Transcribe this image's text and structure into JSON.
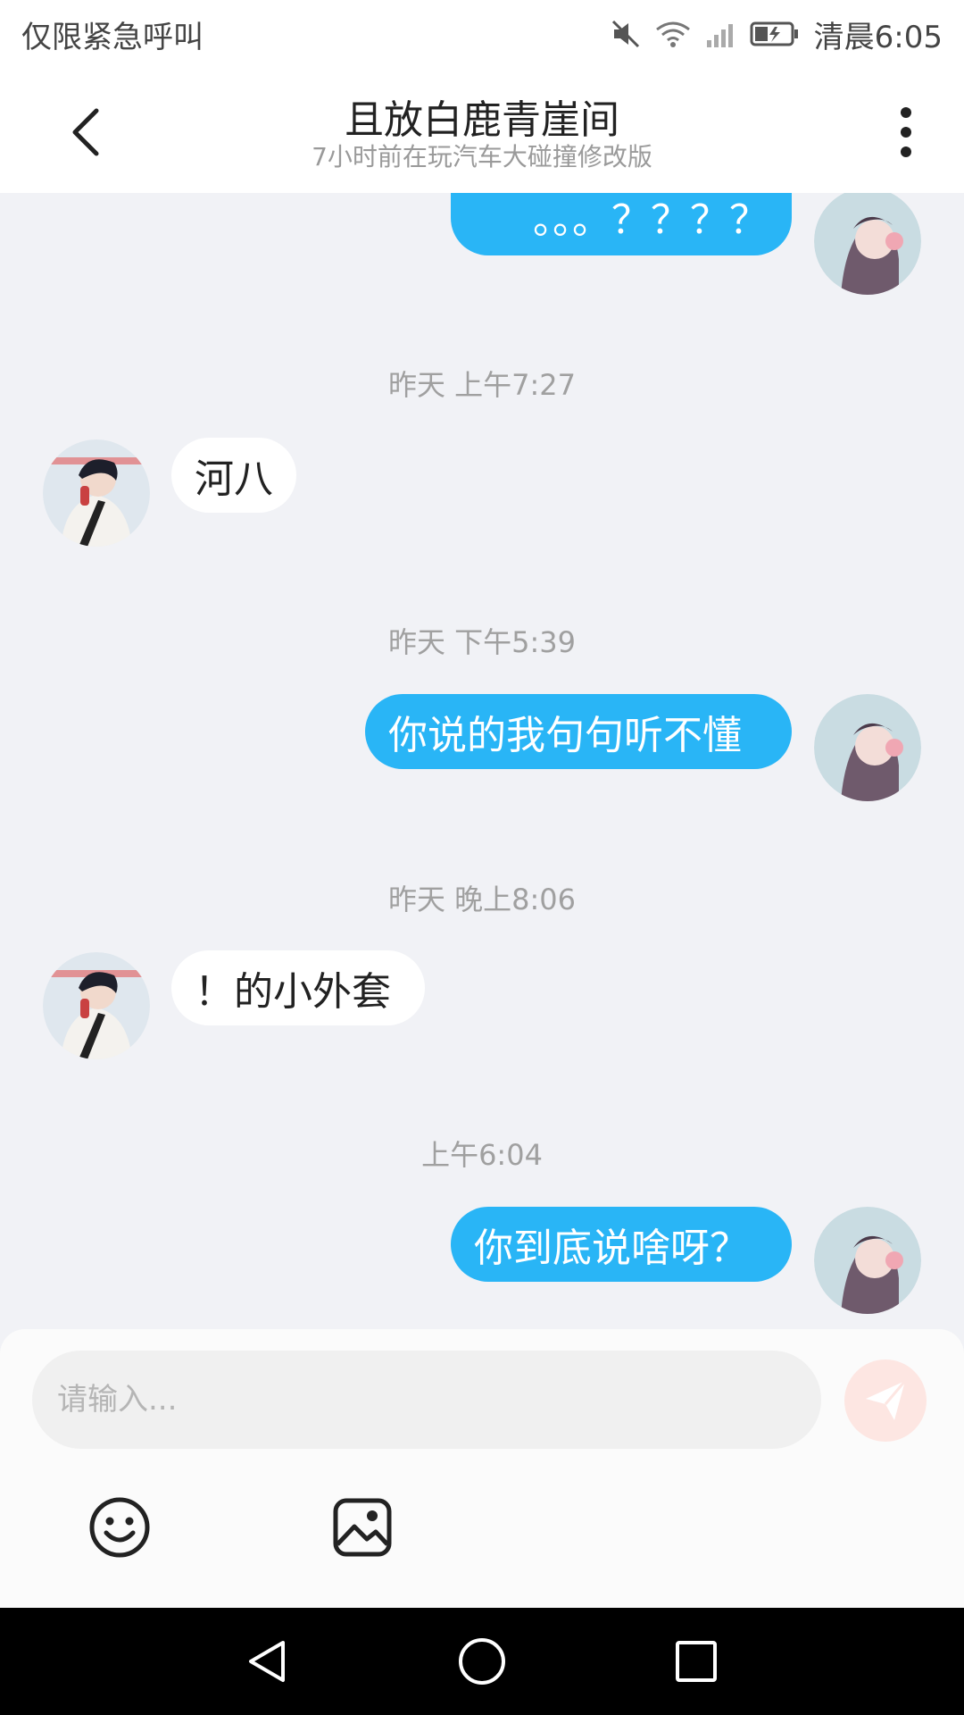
{
  "status_bar": {
    "left_text": "仅限紧急呼叫",
    "time": "清晨6:05",
    "icons": [
      "mute-icon",
      "wifi-icon",
      "signal-icon",
      "battery-icon"
    ]
  },
  "header": {
    "title": "且放白鹿青崖间",
    "subtitle": "7小时前在玩汽车大碰撞修改版",
    "back_icon": "chevron-left-icon",
    "more_icon": "more-vertical-icon"
  },
  "messages": [
    {
      "type": "message",
      "direction": "out",
      "text": "。。。？？？？"
    },
    {
      "type": "timestamp",
      "text": "昨天 上午7:27"
    },
    {
      "type": "message",
      "direction": "in",
      "text": "河八"
    },
    {
      "type": "timestamp",
      "text": "昨天 下午5:39"
    },
    {
      "type": "message",
      "direction": "out",
      "text": "你说的我句句听不懂"
    },
    {
      "type": "timestamp",
      "text": "昨天 晚上8:06"
    },
    {
      "type": "message",
      "direction": "in",
      "text": "！的小外套"
    },
    {
      "type": "timestamp",
      "text": "上午6:04"
    },
    {
      "type": "message",
      "direction": "out",
      "text": "你到底说啥呀？"
    }
  ],
  "composer": {
    "placeholder": "请输入...",
    "send_icon": "send-icon",
    "tools": [
      "emoji-icon",
      "image-icon"
    ]
  },
  "nav_bar": {
    "buttons": [
      "back-triangle-icon",
      "home-circle-icon",
      "recents-square-icon"
    ]
  },
  "colors": {
    "outgoing_bubble": "#29b5f6",
    "incoming_bubble": "#ffffff",
    "chat_background": "#f1f2f6",
    "send_button": "#fde6e2"
  }
}
